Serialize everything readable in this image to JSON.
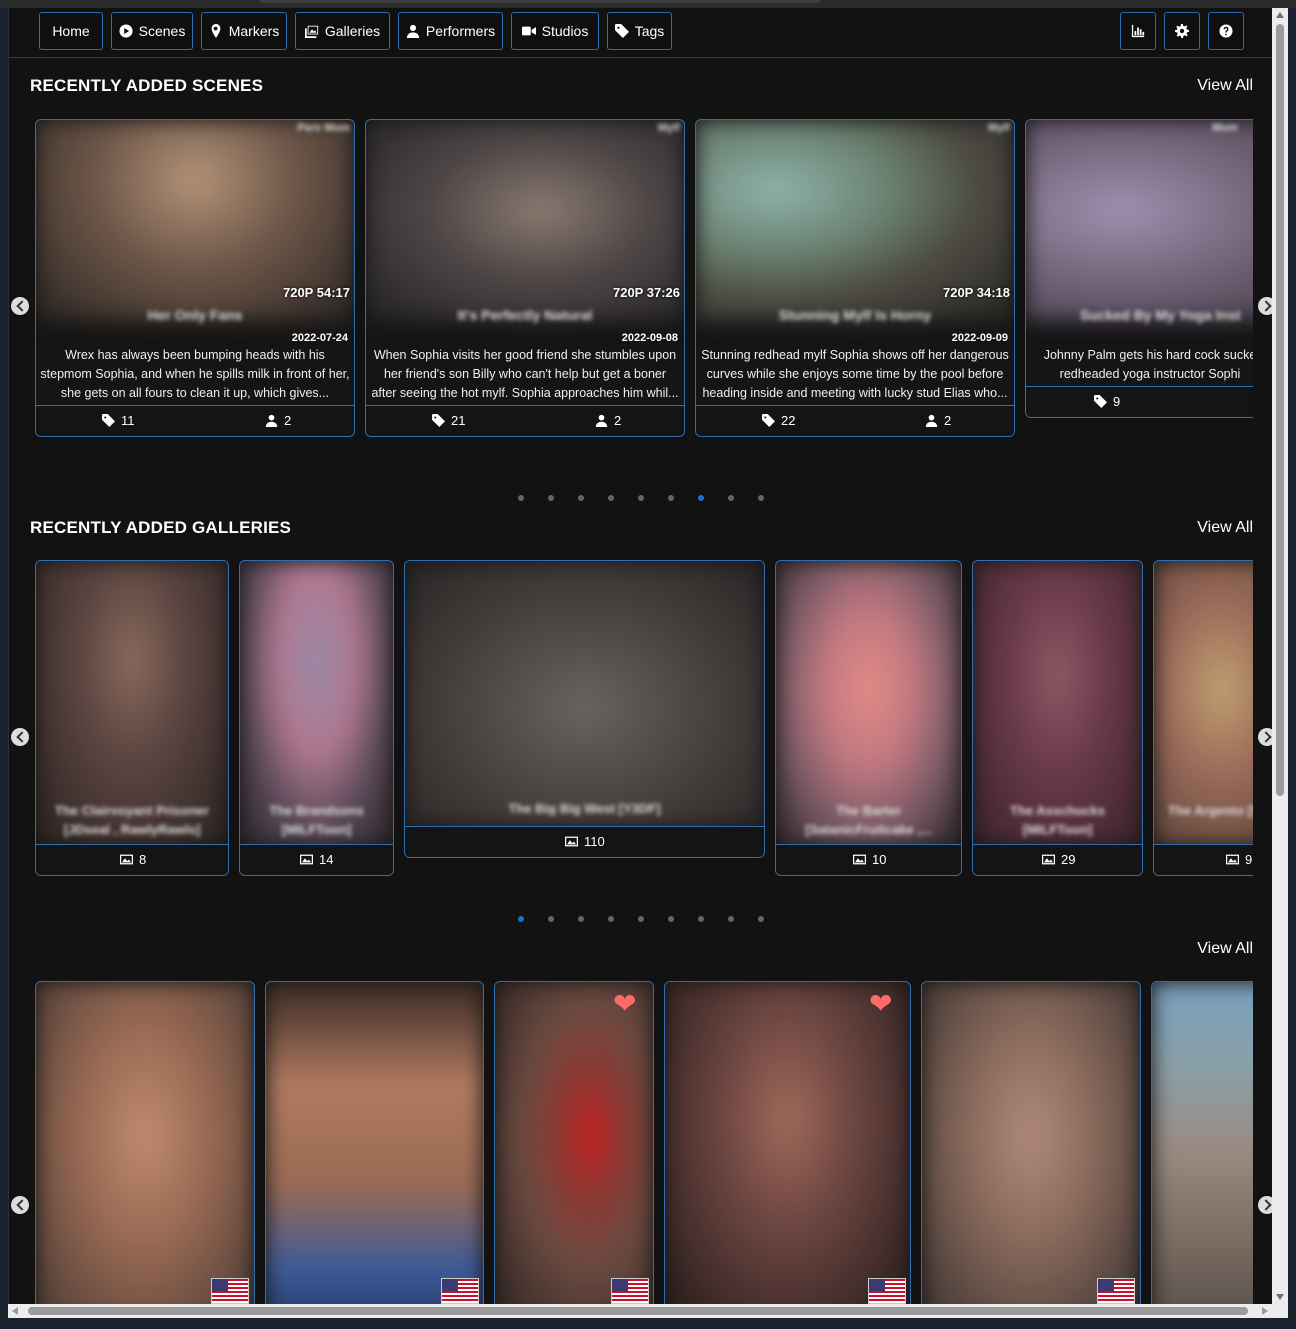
{
  "nav": {
    "items": [
      "Home",
      "Scenes",
      "Markers",
      "Galleries",
      "Performers",
      "Studios",
      "Tags"
    ]
  },
  "scenes_section": {
    "title": "RECENTLY ADDED SCENES",
    "view_all": "View All",
    "cards": [
      {
        "studio": "Perv Mom",
        "resolution": "720P",
        "duration": "54:17",
        "title": "Her Only Fans",
        "date": "2022-07-24",
        "description": "Wrex has always been bumping heads with his stepmom Sophia, and when he spills milk in front of her, she gets on all fours to clean it up, which gives...",
        "tags": "11",
        "performers": "2"
      },
      {
        "studio": "Mylf",
        "resolution": "720P",
        "duration": "37:26",
        "title": "It's Perfectly Natural",
        "date": "2022-09-08",
        "description": "When Sophia visits her good friend she stumbles upon her friend's son Billy who can't help but get a boner after seeing the hot mylf. Sophia approaches him whil...",
        "tags": "21",
        "performers": "2"
      },
      {
        "studio": "Mylf",
        "resolution": "720P",
        "duration": "34:18",
        "title": "Stunning Mylf Is Horny",
        "date": "2022-09-09",
        "description": "Stunning redhead mylf Sophia shows off her dangerous curves while she enjoys some time by the pool before heading inside and meeting with lucky stud Elias who...",
        "tags": "22",
        "performers": "2"
      },
      {
        "studio": "Mom",
        "resolution": "",
        "duration": "",
        "title": "Sucked By My Yoga Inst",
        "date": "",
        "description": "Johnny Palm gets his hard cock sucke redheaded yoga instructor Sophi",
        "tags": "9",
        "performers": ""
      }
    ],
    "active_dot": 6,
    "dot_count": 9
  },
  "galleries_section": {
    "title": "RECENTLY ADDED GALLERIES",
    "view_all": "View All",
    "cards": [
      {
        "title": "The Clairvoyant Prisoner [JDseal , RawlyRawls]",
        "images": "8"
      },
      {
        "title": "The Brandsons [MILFToon]",
        "images": "14"
      },
      {
        "title": "The Big Big West [Y3DF]",
        "images": "110"
      },
      {
        "title": "The Barter [SatanicFruitcake ,...",
        "images": "10"
      },
      {
        "title": "The Asschucks [MILFToon]",
        "images": "29"
      },
      {
        "title": "The Argento [Marcos",
        "images": "9"
      }
    ],
    "active_dot": 0,
    "dot_count": 9
  },
  "performers_section": {
    "view_all": "View All",
    "cards": [
      {
        "favorite": false,
        "flag": "us-flag"
      },
      {
        "favorite": false,
        "flag": "us-flag"
      },
      {
        "favorite": true,
        "flag": "us-flag"
      },
      {
        "favorite": true,
        "flag": "us-flag"
      },
      {
        "favorite": false,
        "flag": "us-flag"
      },
      {
        "favorite": false,
        "flag": ""
      }
    ]
  },
  "colors": {
    "accent": "#2f6fb0",
    "background": "#121212",
    "heart": "#ff6b6b",
    "dot_active": "#1a73c9"
  }
}
